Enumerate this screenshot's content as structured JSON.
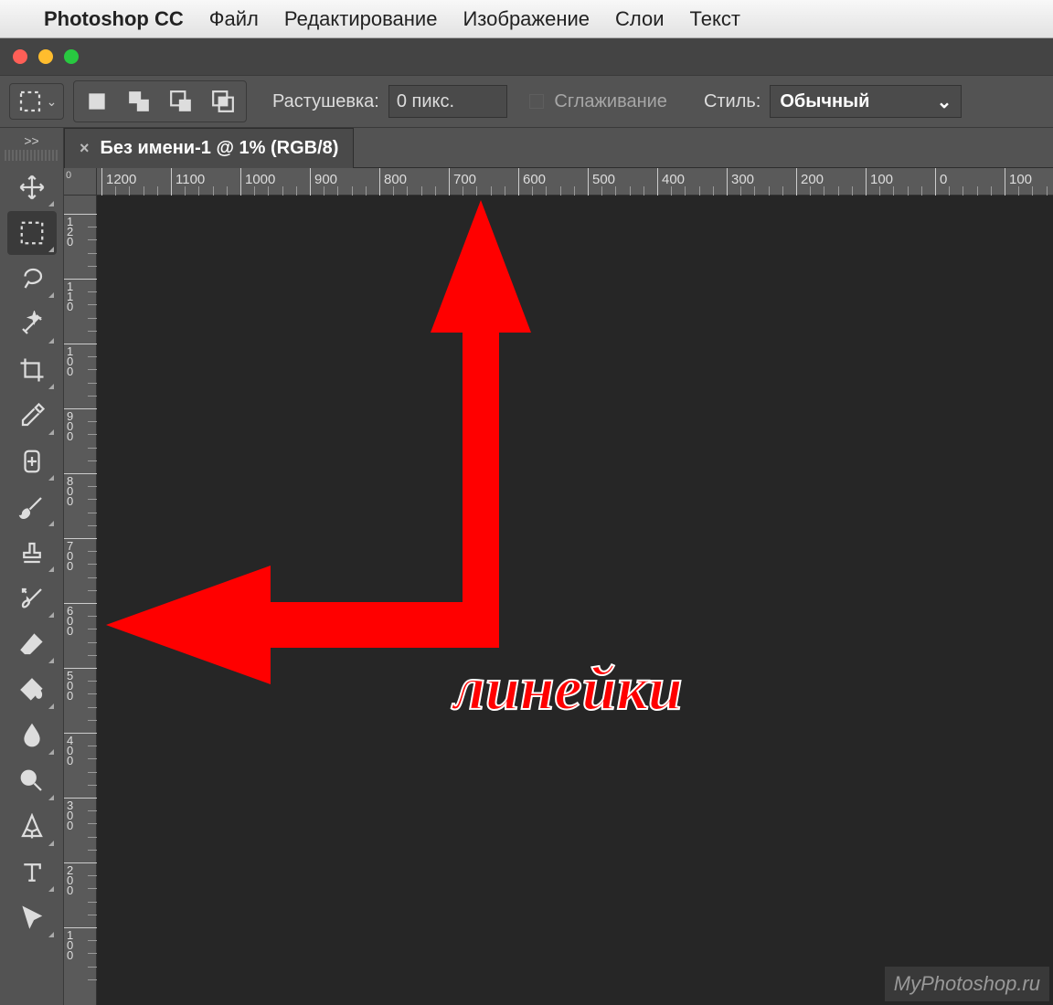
{
  "menubar": {
    "app_name": "Photoshop CC",
    "items": [
      "Файл",
      "Редактирование",
      "Изображение",
      "Слои",
      "Текст"
    ]
  },
  "window": {
    "close_color": "#ff5f57",
    "min_color": "#ffbd2e",
    "max_color": "#28c940"
  },
  "optbar": {
    "feather_label": "Растушевка:",
    "feather_value": "0 пикс.",
    "antialias_label": "Сглаживание",
    "style_label": "Стиль:",
    "style_value": "Обычный"
  },
  "doc_tab": {
    "close": "×",
    "title": "Без имени-1 @ 1% (RGB/8)"
  },
  "ruler": {
    "corner": "0",
    "h_ticks": [
      "1200",
      "1100",
      "1000",
      "900",
      "800",
      "700",
      "600",
      "500",
      "400",
      "300",
      "200",
      "100",
      "0",
      "100"
    ],
    "v_ticks": [
      "1\n2\n0",
      "1\n1\n0",
      "1\n0\n0",
      "9\n0\n0",
      "8\n0\n0",
      "7\n0\n0",
      "6\n0\n0",
      "5\n0\n0",
      "4\n0\n0",
      "3\n0\n0",
      "2\n0\n0",
      "1\n0\n0"
    ]
  },
  "tools": [
    {
      "name": "move-tool"
    },
    {
      "name": "marquee-tool",
      "active": true
    },
    {
      "name": "lasso-tool"
    },
    {
      "name": "magic-wand-tool"
    },
    {
      "name": "crop-tool"
    },
    {
      "name": "eyedropper-tool"
    },
    {
      "name": "healing-brush-tool"
    },
    {
      "name": "brush-tool"
    },
    {
      "name": "stamp-tool"
    },
    {
      "name": "history-brush-tool"
    },
    {
      "name": "eraser-tool"
    },
    {
      "name": "paint-bucket-tool"
    },
    {
      "name": "blur-tool"
    },
    {
      "name": "dodge-tool"
    },
    {
      "name": "pen-tool"
    },
    {
      "name": "type-tool"
    },
    {
      "name": "path-select-tool"
    }
  ],
  "toolbar_expand": ">>",
  "annotation": {
    "text": "линейки",
    "arrow_color": "#ff0000"
  },
  "watermark": "MyPhotoshop.ru"
}
